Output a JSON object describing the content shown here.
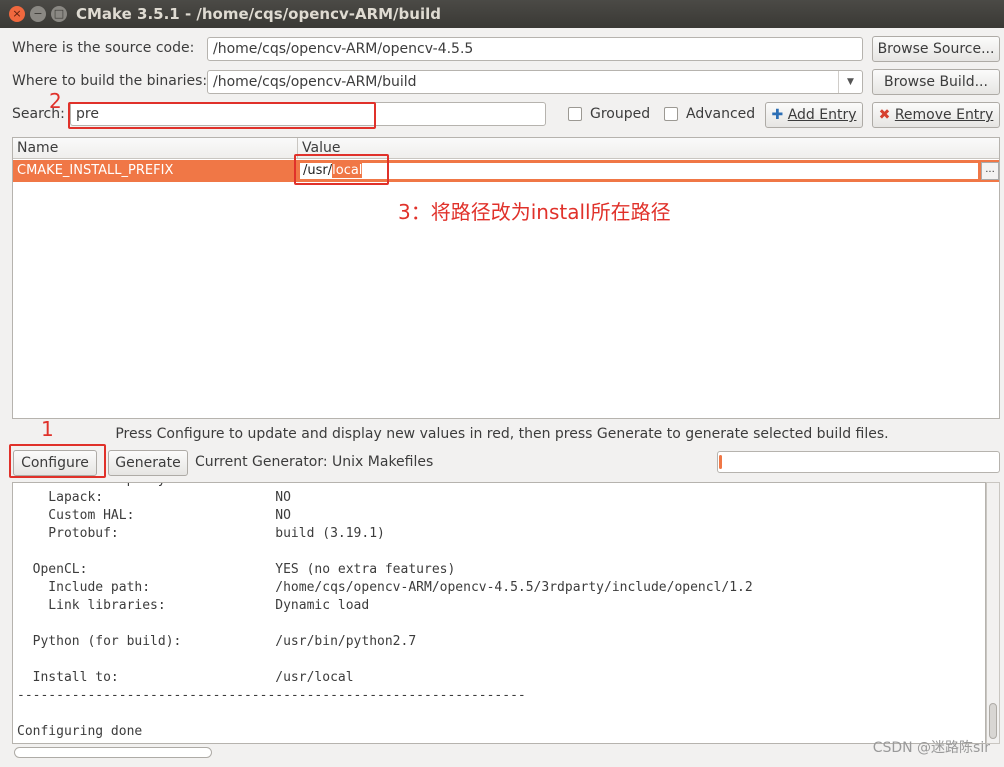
{
  "window": {
    "title": "CMake 3.5.1 - /home/cqs/opencv-ARM/build",
    "close_glyph": "×",
    "min_glyph": "−",
    "max_glyph": "□"
  },
  "source": {
    "label": "Where is the source code:",
    "value": "/home/cqs/opencv-ARM/opencv-4.5.5",
    "browse_label": "Browse Source..."
  },
  "build": {
    "label": "Where to build the binaries:",
    "value": "/home/cqs/opencv-ARM/build",
    "browse_label": "Browse Build..."
  },
  "search": {
    "label": "Search:",
    "value": "pre"
  },
  "options": {
    "grouped_label": "Grouped",
    "grouped_checked": false,
    "advanced_label": "Advanced",
    "advanced_checked": false,
    "add_entry_label": "Add Entry",
    "remove_entry_label": "Remove Entry"
  },
  "table": {
    "columns": [
      "Name",
      "Value"
    ],
    "rows": [
      {
        "name": "CMAKE_INSTALL_PREFIX",
        "value_prefix": "/usr/",
        "value_selected": "local"
      }
    ],
    "ellipsis_label": "..."
  },
  "annotations": {
    "step1": "1",
    "step2": "2",
    "step3": "3：将路径改为install所在路径"
  },
  "info_text": "Press Configure to update and display new values in red, then press Generate to generate selected build files.",
  "actions": {
    "configure_label": "Configure",
    "generate_label": "Generate",
    "generator_text": "Current Generator: Unix Makefiles"
  },
  "progress": {
    "fraction": 0.01
  },
  "output_log": "  Other third-party libraries:\n    Lapack:                      NO\n    Custom HAL:                  NO\n    Protobuf:                    build (3.19.1)\n\n  OpenCL:                        YES (no extra features)\n    Include path:                /home/cqs/opencv-ARM/opencv-4.5.5/3rdparty/include/opencl/1.2\n    Link libraries:              Dynamic load\n\n  Python (for build):            /usr/bin/python2.7\n\n  Install to:                    /usr/local\n-----------------------------------------------------------------\n\nConfiguring done",
  "watermark": "CSDN @迷路陈sir",
  "colors": {
    "accent": "#f07746",
    "annotation": "#e0312a",
    "titlebar": "#3c3b37"
  }
}
